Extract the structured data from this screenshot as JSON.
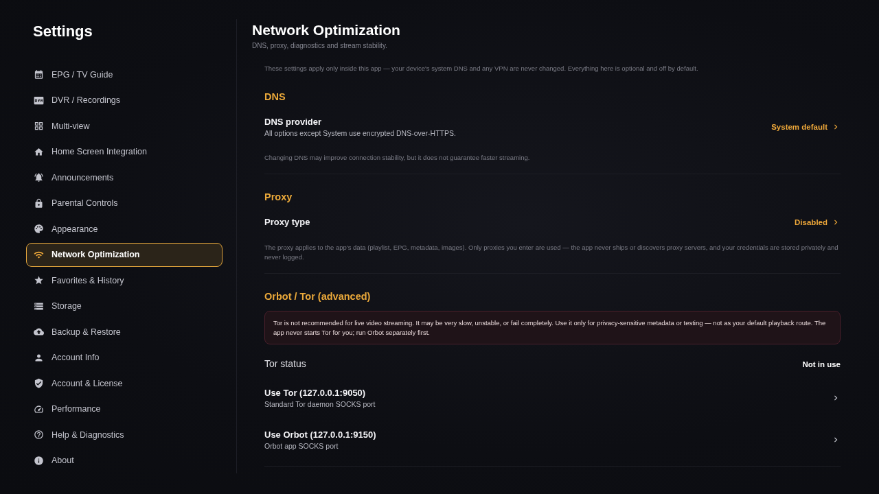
{
  "sidebar": {
    "title": "Settings",
    "items": [
      {
        "label": "EPG / TV Guide",
        "selected": false
      },
      {
        "label": "DVR / Recordings",
        "selected": false
      },
      {
        "label": "Multi-view",
        "selected": false
      },
      {
        "label": "Home Screen Integration",
        "selected": false
      },
      {
        "label": "Announcements",
        "selected": false
      },
      {
        "label": "Parental Controls",
        "selected": false
      },
      {
        "label": "Appearance",
        "selected": false
      },
      {
        "label": "Network Optimization",
        "selected": true
      },
      {
        "label": "Favorites & History",
        "selected": false
      },
      {
        "label": "Storage",
        "selected": false
      },
      {
        "label": "Backup & Restore",
        "selected": false
      },
      {
        "label": "Account Info",
        "selected": false
      },
      {
        "label": "Account & License",
        "selected": false
      },
      {
        "label": "Performance",
        "selected": false
      },
      {
        "label": "Help & Diagnostics",
        "selected": false
      },
      {
        "label": "About",
        "selected": false
      }
    ]
  },
  "page": {
    "title": "Network Optimization",
    "subtitle": "DNS, proxy, diagnostics and stream stability."
  },
  "intro_note": "These settings apply only inside this app — your device's system DNS and any VPN are never changed. Everything here is optional and off by default.",
  "sections": [
    {
      "heading": "DNS",
      "items": [
        {
          "kind": "select",
          "label": "DNS provider",
          "description": "All options except System use encrypted DNS-over-HTTPS.",
          "value": "System default"
        },
        {
          "kind": "note",
          "text": "Changing DNS may improve connection stability, but it does not guarantee faster streaming."
        }
      ]
    },
    {
      "heading": "Proxy",
      "items": [
        {
          "kind": "select",
          "label": "Proxy type",
          "value": "Disabled"
        },
        {
          "kind": "note",
          "text": "The proxy applies to the app's data (playlist, EPG, metadata, images). Only proxies you enter are used — the app never ships or discovers proxy servers, and your credentials are stored privately and never logged."
        }
      ]
    },
    {
      "heading": "Orbot / Tor (advanced)",
      "items": [
        {
          "kind": "warning",
          "text": "Tor is not recommended for live video streaming. It may be very slow, unstable, or fail completely. Use it only for privacy-sensitive metadata or testing — not as your default playback route. The app never starts Tor for you; run Orbot separately first."
        },
        {
          "kind": "status",
          "label": "Tor status",
          "value": "Not in use"
        },
        {
          "kind": "link",
          "label": "Use Tor (127.0.0.1:9050)",
          "description": "Standard Tor daemon SOCKS port"
        },
        {
          "kind": "link",
          "label": "Use Orbot (127.0.0.1:9150)",
          "description": "Orbot app SOCKS port"
        }
      ]
    }
  ]
}
